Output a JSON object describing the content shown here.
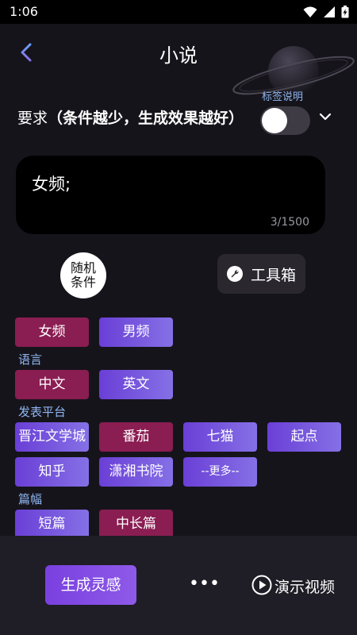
{
  "status_bar": {
    "time": "1:06"
  },
  "header": {
    "title": "小说"
  },
  "requirement": {
    "label_prefix": "要求",
    "label_hint": "（条件越少，生成效果越好）",
    "tag_help_label": "标签说明",
    "toggle_on": false
  },
  "text_area": {
    "value": "女频;",
    "char_count": "3/1500"
  },
  "random_button": {
    "line1": "随机",
    "line2": "条件"
  },
  "toolbox_button": {
    "label": "工具箱"
  },
  "options": {
    "gender": {
      "chips": [
        {
          "label": "女频",
          "selected": true
        },
        {
          "label": "男频",
          "selected": false
        }
      ]
    },
    "language": {
      "title": "语言",
      "chips": [
        {
          "label": "中文",
          "selected": true
        },
        {
          "label": "英文",
          "selected": false
        }
      ]
    },
    "platform": {
      "title": "发表平台",
      "chips": [
        {
          "label": "晋江文学城",
          "selected": false
        },
        {
          "label": "番茄",
          "selected": true
        },
        {
          "label": "七猫",
          "selected": false
        },
        {
          "label": "起点",
          "selected": false
        },
        {
          "label": "知乎",
          "selected": false
        },
        {
          "label": "潇湘书院",
          "selected": false
        },
        {
          "label": "--更多--",
          "selected": false
        }
      ]
    },
    "length": {
      "title": "篇幅",
      "chips": [
        {
          "label": "短篇",
          "selected": false
        },
        {
          "label": "中长篇",
          "selected": true
        }
      ]
    }
  },
  "bottom_bar": {
    "generate_label": "生成灵感",
    "more_label": "•••",
    "demo_label": "演示视频"
  },
  "colors": {
    "background": "#16141b",
    "selected_chip": "#8a1d52",
    "unselected_chip_start": "#6a3fd6",
    "unselected_chip_end": "#8570e6",
    "section_label": "#8fb7f2"
  }
}
